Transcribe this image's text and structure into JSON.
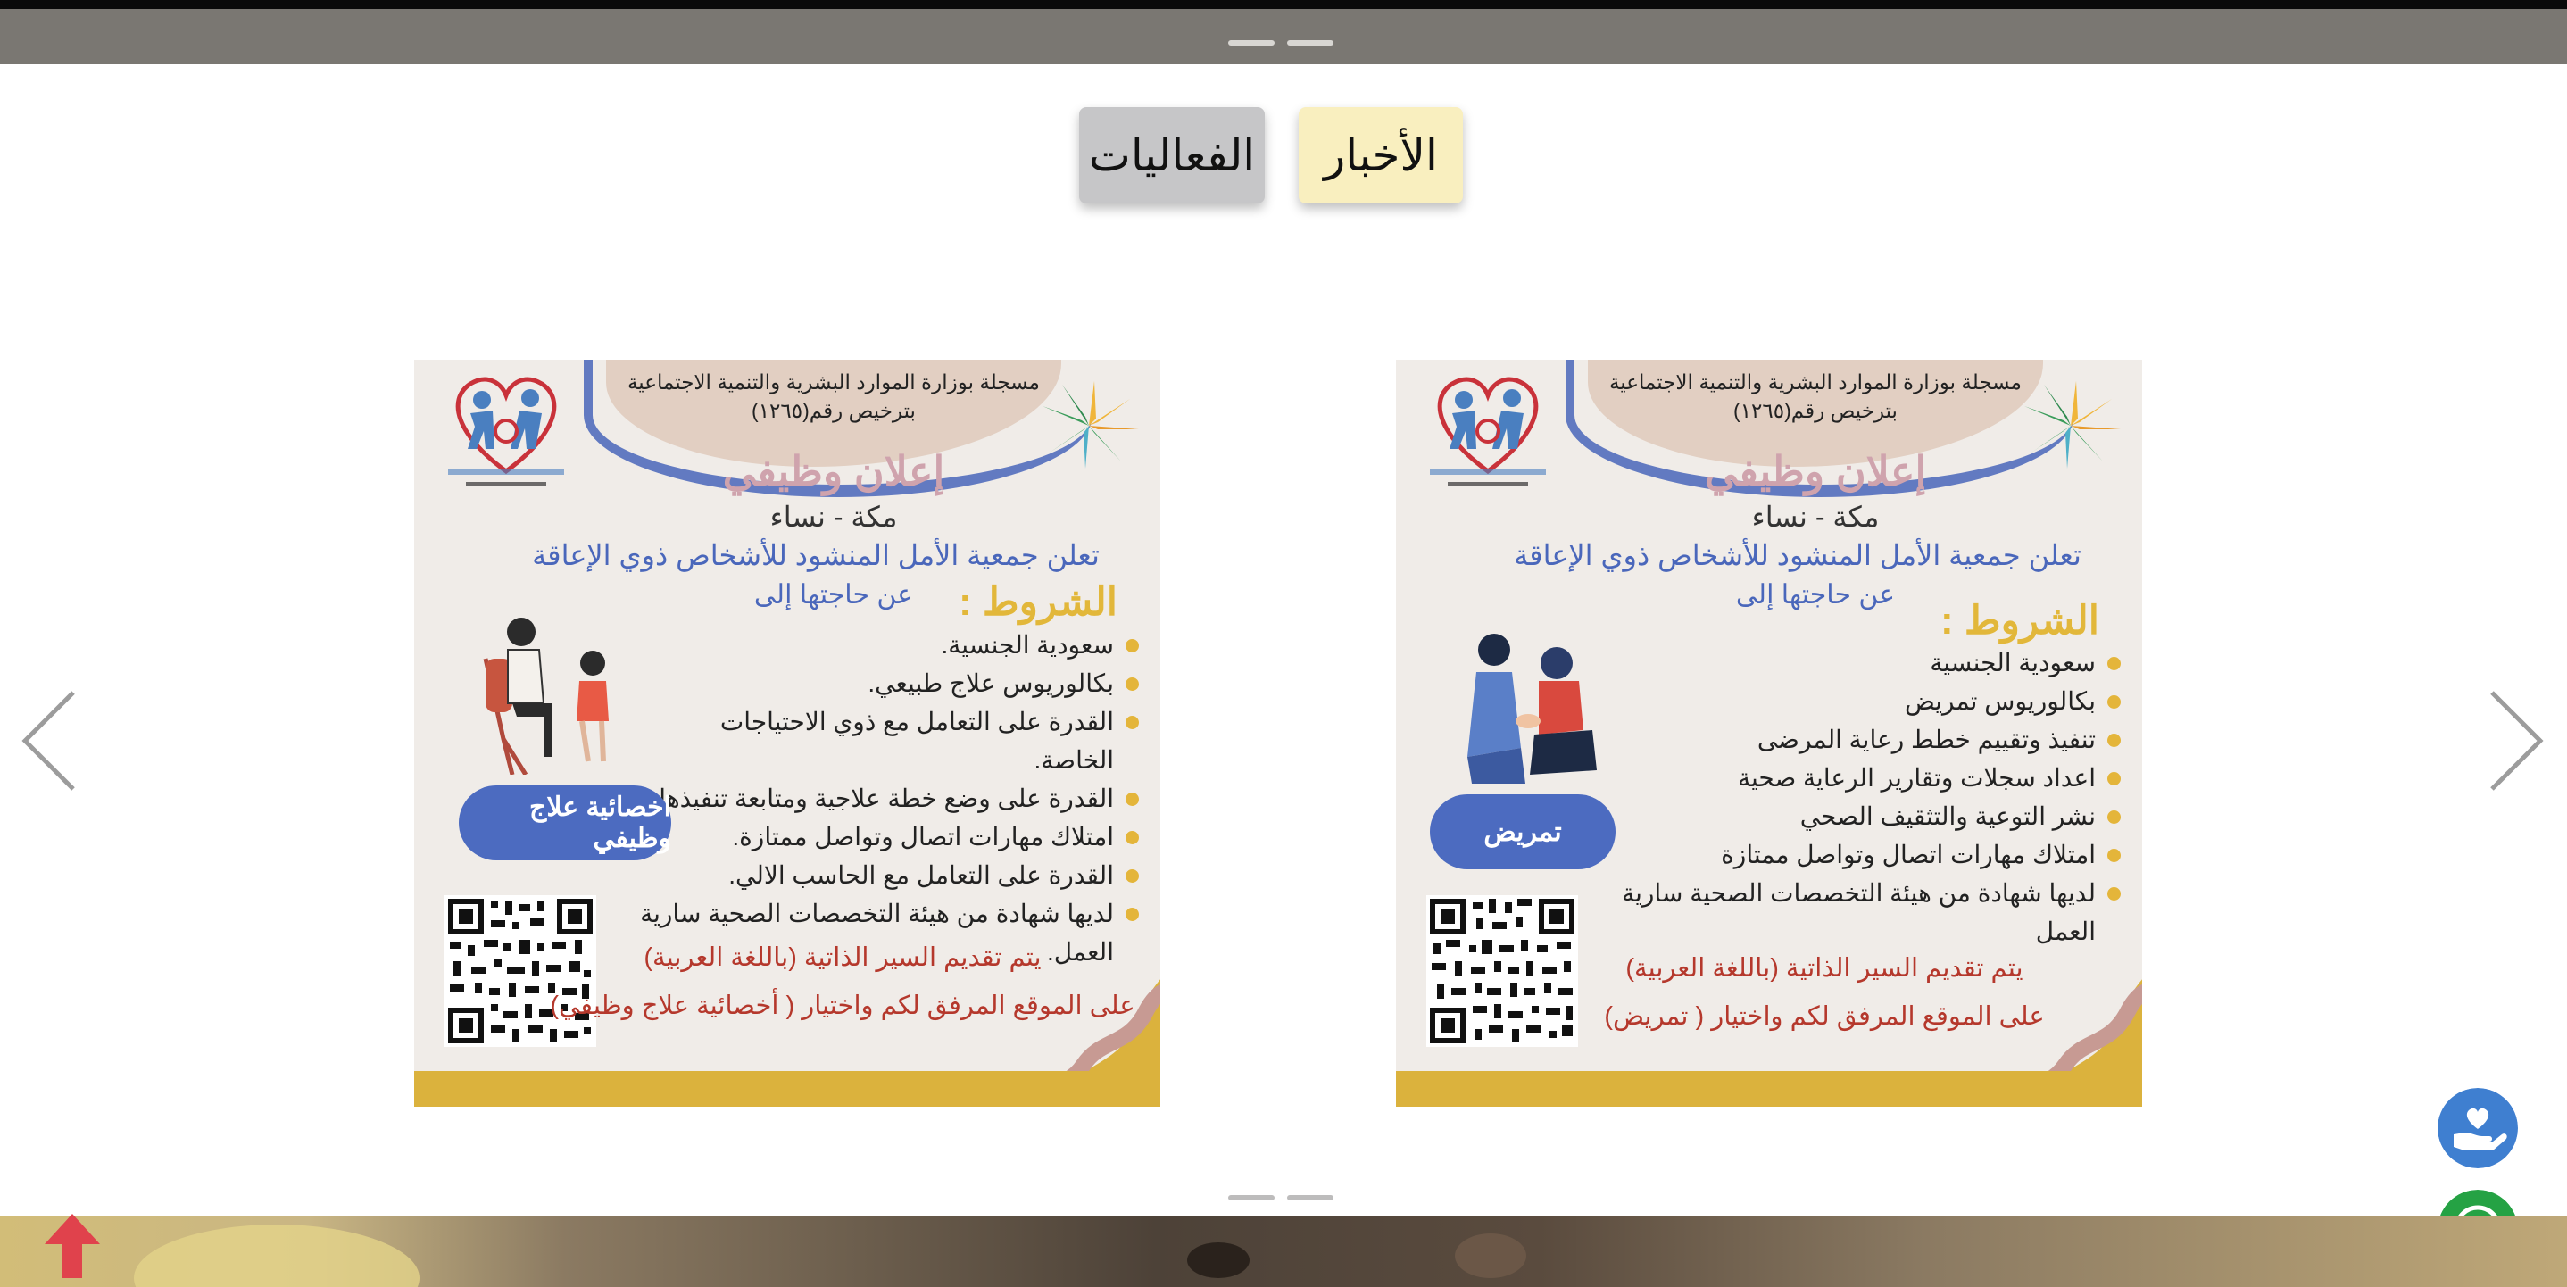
{
  "tabs": [
    {
      "label": "الفعاليات"
    },
    {
      "label": "الأخبار"
    }
  ],
  "colors": {
    "accent_blue": "#4a67bb",
    "gold": "#dbb23d",
    "heading_pink": "#cfa3ad",
    "cta_red": "#b5382c",
    "whatsapp_green": "#25a244",
    "scroll_top_red": "#e0424c"
  },
  "icons": {
    "prev": "chevron-left-icon",
    "next": "chevron-right-icon",
    "donate": "hand-heart-icon",
    "whatsapp": "whatsapp-icon",
    "scroll_top": "arrow-up-icon"
  },
  "cards": [
    {
      "registration_line1": "مسجلة بوزارة الموارد البشرية والتنمية الاجتماعية",
      "registration_line2": "بترخيص رقم(١٢٦٥)",
      "heading": "إعلان وظيفي",
      "location": "مكة - نساء",
      "announce": "تعلن جمعية الأمل المنشود للأشخاص ذوي الإعاقة",
      "need": "عن حاجتها إلى",
      "conditions_title": "الشروط :",
      "conditions": [
        "سعودية الجنسية.",
        "بكالوريوس علاج طبيعي.",
        "القدرة على التعامل مع ذوي الاحتياجات الخاصة.",
        "القدرة على وضع خطة علاجية ومتابعة تنفيذها.",
        "امتلاك مهارات اتصال وتواصل ممتازة.",
        "القدرة على التعامل مع الحاسب الالي.",
        "لديها شهادة من هيئة التخصصات الصحية سارية العمل."
      ],
      "position": "اخصائية علاج وظيفي",
      "cv_note": "يتم تقديم السير الذاتية (باللغة العربية)",
      "site_note": "على الموقع المرفق لكم واختيار ( أخصائية علاج وظيفي)"
    },
    {
      "registration_line1": "مسجلة بوزارة الموارد البشرية والتنمية الاجتماعية",
      "registration_line2": "بترخيص رقم(١٢٦٥)",
      "heading": "إعلان وظيفي",
      "location": "مكة - نساء",
      "announce": "تعلن جمعية الأمل المنشود للأشخاص ذوي الإعاقة",
      "need": "عن حاجتها إلى",
      "conditions_title": "الشروط :",
      "conditions": [
        "سعودية الجنسية",
        "بكالوريوس تمريض",
        "تنفيذ وتقييم خطط رعاية المرضى",
        "اعداد سجلات وتقارير الرعاية صحية",
        "نشر التوعية والتثقيف الصحي",
        "امتلاك مهارات اتصال وتواصل ممتازة",
        "لديها شهادة من هيئة التخصصات الصحية سارية العمل"
      ],
      "position": "تمريض",
      "cv_note": "يتم تقديم السير الذاتية (باللغة العربية)",
      "site_note": "على الموقع المرفق لكم واختيار ( تمريض)"
    }
  ]
}
